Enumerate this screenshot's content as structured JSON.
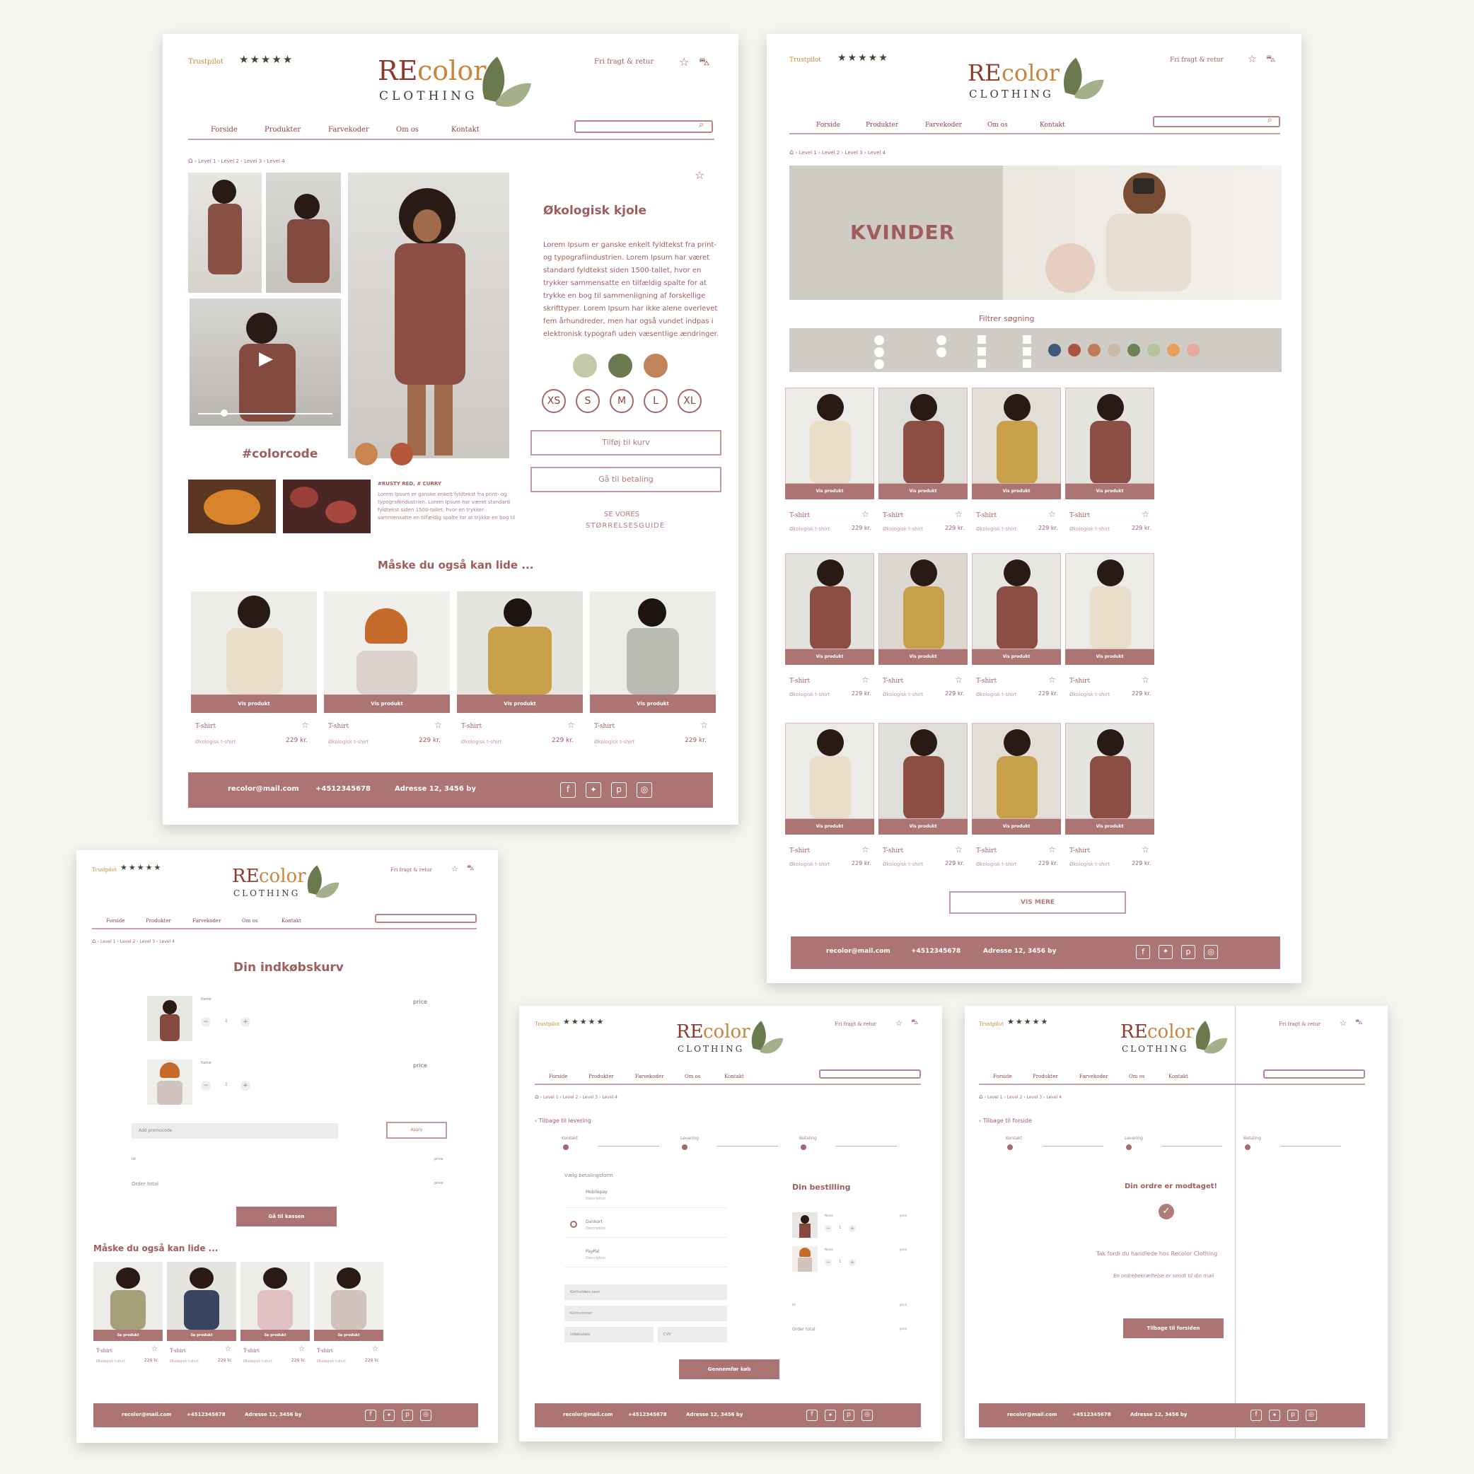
{
  "header": {
    "trustpilot": "Trustpilot",
    "stars": "★★★★★",
    "logo_re": "RE",
    "logo_color": "color",
    "logo_clothing": "CLOTHING",
    "shipping": "Fri fragt & retur",
    "nav": [
      "Forside",
      "Produkter",
      "Farvekoder",
      "Om os",
      "Kontakt"
    ]
  },
  "breadcrumb": [
    "Level 1",
    "Level 2",
    "Level 3",
    "Level 4"
  ],
  "product_page": {
    "title": "Økologisk kjole",
    "description": "Lorem Ipsum er ganske enkelt fyldtekst fra print- og typografiindustrien. Lorem Ipsum har været standard fyldtekst siden 1500-tallet, hvor en trykker sammensatte en tilfældig spalte for at trykke en bog til sammenligning af forskellige skrifttyper. Lorem Ipsum har ikke alene overlevet fem århundreder, men har også vundet indpas i elektronisk typografi uden væsentlige ændringer.",
    "sizes": [
      "XS",
      "S",
      "M",
      "L",
      "XL"
    ],
    "colors": [
      "#c4c9ab",
      "#6b7a4e",
      "#c08458"
    ],
    "add_to_cart": "Tilføj til kurv",
    "checkout": "Gå til betaling",
    "size_guide_1": "SE VORES",
    "size_guide_2": "STØRRELSESGUIDE",
    "colorcode": "#colorcode",
    "colorcode_swatches": [
      "#c98452",
      "#b5553a"
    ],
    "colorcode_title": "#RUSTY RED, # CURRY",
    "colorcode_text": "Lorem Ipsum er ganske enkelt fyldtekst fra print- og typografiindustrien. Lorem Ipsum har været standard fyldtekst siden 1500-tallet, hvor en trykker sammensatte en tilfældig spalte for at trykke en bog til",
    "also_like": "Måske du også kan lide ...",
    "cards": [
      {
        "bar": "Vis produkt",
        "title": "T-shirt",
        "desc": "Økologisk t-shirt",
        "price": "229 kr."
      },
      {
        "bar": "Vis produkt",
        "title": "T-shirt",
        "desc": "Økologisk t-shirt",
        "price": "229 kr."
      },
      {
        "bar": "Vis produkt",
        "title": "T-shirt",
        "desc": "Økologisk t-shirt",
        "price": "229 kr."
      },
      {
        "bar": "Vis produkt",
        "title": "T-shirt",
        "desc": "Økologisk t-shirt",
        "price": "229 kr."
      }
    ]
  },
  "category_page": {
    "hero": "KVINDER",
    "filter_title": "Filtrer søgning",
    "filter_colors": [
      "#3e5a78",
      "#a85540",
      "#c07c5a",
      "#c9bca7",
      "#6d8256",
      "#b5c49e",
      "#e6a25a",
      "#e8a9a0"
    ],
    "card": {
      "bar": "Vis produkt",
      "title": "T-shirt",
      "desc": "Økologisk t-shirt",
      "price": "229 kr."
    },
    "show_more": "VIS MERE"
  },
  "footer": {
    "email": "recolor@mail.com",
    "phone": "+4512345678",
    "address": "Adresse 12, 3456 by"
  },
  "cart_page": {
    "title": "Din indkøbskurv",
    "item_name": "Name",
    "price": "price",
    "qty": "1",
    "promo_placeholder": "Add promocode",
    "apply": "Apply",
    "subtotal_label": "Ist",
    "subtotal_value": "price",
    "order_total": "Order total",
    "order_total_value": "price",
    "checkout": "Gå til kassen",
    "also_like": "Måske du også kan lide ...",
    "card": {
      "bar": "Se produkt",
      "title": "T-shirt",
      "desc": "Økologisk t-shirt",
      "price": "229 kr."
    }
  },
  "payment_page": {
    "back": "Tilbage til levering",
    "steps": [
      "Kontakt",
      "Levering",
      "Betaling"
    ],
    "choose": "Vælg betalingsform",
    "options": [
      {
        "name": "Mobilepay",
        "desc": "Description"
      },
      {
        "name": "Dankort",
        "desc": "Description"
      },
      {
        "name": "PayPal",
        "desc": "Description"
      }
    ],
    "fields": [
      "Kortholders navn",
      "Kortnummer",
      "Udløbsdato",
      "CVV"
    ],
    "submit": "Gennemfør køb",
    "order_title": "Din bestilling",
    "item_name": "Name",
    "price": "price",
    "qty": "1",
    "subtotal_label": "Ist",
    "subtotal_value": "price",
    "order_total": "Order total",
    "order_total_value": "price"
  },
  "confirm_page": {
    "back": "Tilbage til forside",
    "steps": [
      "Kontakt",
      "Levering",
      "Betaling"
    ],
    "title": "Din ordre er modtaget!",
    "thanks": "Tak fordi du handlede hos Recolor Clothing",
    "email_note": "En ordrebekræftelse er sendt til din mail",
    "button": "Tilbage til forsiden"
  }
}
